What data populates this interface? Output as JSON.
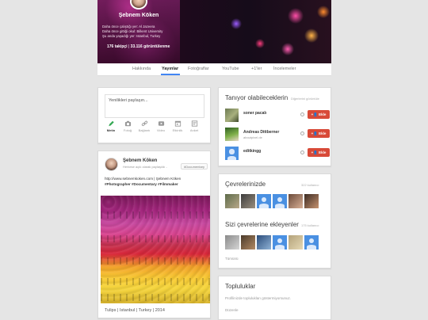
{
  "profile": {
    "name": "Şebnem Köken",
    "lines": [
      "Daha önce çalıştığı yer: Al Jazeera",
      "Daha önce gittiği okul: Bilkent University",
      "Şu anda yaşadığı yer: Istanbul, Turkey"
    ],
    "followers": "176 takipçi",
    "separator": "|",
    "views": "33.116 görüntülenme"
  },
  "tabs": [
    {
      "label": "Hakkında"
    },
    {
      "label": "Yayınlar",
      "active": true
    },
    {
      "label": "Fotoğraflar"
    },
    {
      "label": "YouTube"
    },
    {
      "label": "+1'ler"
    },
    {
      "label": "İncelemeler"
    }
  ],
  "share": {
    "placeholder": "Yenilikleri paylaşın...",
    "actions": [
      {
        "label": "Metin",
        "icon": "pencil-icon",
        "active": true
      },
      {
        "label": "Fotoğ",
        "icon": "camera-icon"
      },
      {
        "label": "Bağlantı",
        "icon": "link-icon"
      },
      {
        "label": "Video",
        "icon": "video-icon"
      },
      {
        "label": "Etkinlik",
        "icon": "calendar-icon"
      },
      {
        "label": "Anket",
        "icon": "poll-icon"
      }
    ]
  },
  "post": {
    "author": "Şebnem Köken",
    "meta": "Herkese açık olarak paylaşıldı  -  ",
    "tag": "#Documentary",
    "link": "http://www.sebnemkoken.com | Şebnem Köken",
    "hashtags": "#Photographer #Documentary #Filmmaker",
    "caption": "Tulips | Istanbul | Turkey | 2014"
  },
  "suggestions": {
    "title": "Tanıyor olabileceklerin",
    "more": "Diğerlerini görüntüle",
    "add_label": "Ekle",
    "people": [
      {
        "name": "soner pacalı",
        "url": ""
      },
      {
        "name": "Andreas Dittberner",
        "url": "aboutpixel.de"
      },
      {
        "name": "editkingg",
        "url": ""
      }
    ]
  },
  "circles": {
    "title": "Çevrelerinizde",
    "count": "322 kullanıcı"
  },
  "added_by": {
    "title": "Sizi çevrelerine ekleyenler",
    "count": "175 kullanıcı",
    "more": "Tümünü"
  },
  "communities": {
    "title": "Topluluklar",
    "text": "Profilinizde toplulukları göstermiyorsunuz.",
    "edit": "Düzenle"
  },
  "colors": {
    "accent": "#4285f4",
    "add_button": "#d84a38"
  }
}
